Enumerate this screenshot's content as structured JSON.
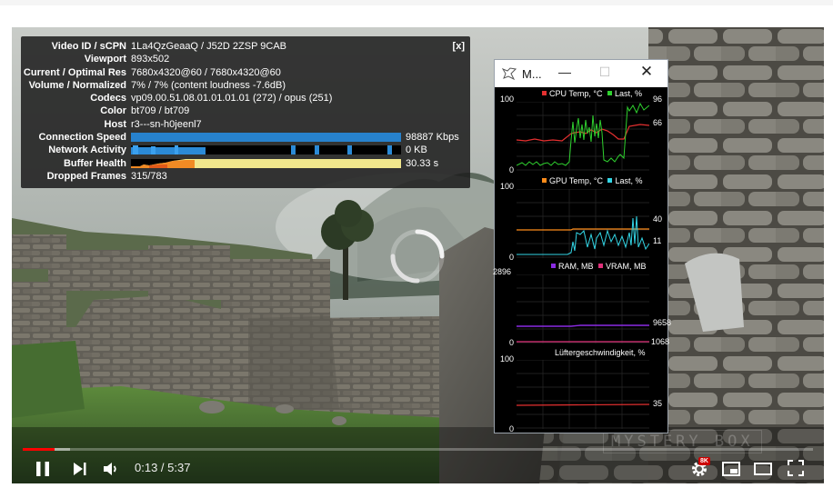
{
  "stats": {
    "close_label": "[x]",
    "rows": [
      {
        "key": "Video ID / sCPN",
        "value": "1La4QzGeaaQ / J52D 2ZSP 9CAB"
      },
      {
        "key": "Viewport",
        "value": "893x502"
      },
      {
        "key": "Current / Optimal Res",
        "value": "7680x4320@60 / 7680x4320@60"
      },
      {
        "key": "Volume / Normalized",
        "value": "7% / 7% (content loudness -7.6dB)"
      },
      {
        "key": "Codecs",
        "value": "vp09.00.51.08.01.01.01.01 (272) / opus (251)"
      },
      {
        "key": "Color",
        "value": "bt709 / bt709"
      },
      {
        "key": "Host",
        "value": "r3---sn-h0jeenl7"
      }
    ],
    "connection_speed": {
      "key": "Connection Speed",
      "value": "98887 Kbps"
    },
    "network_activity": {
      "key": "Network Activity",
      "value": "0 KB"
    },
    "buffer_health": {
      "key": "Buffer Health",
      "value": "30.33 s"
    },
    "dropped_frames": {
      "key": "Dropped Frames",
      "value": "315/783"
    }
  },
  "player": {
    "time": "0:13 / 5:37",
    "watermark": "MYSTERY BOX",
    "progress_fraction": 0.04,
    "buffer_fraction": 0.06,
    "settings_badge": "8K"
  },
  "monitor": {
    "title": "M...",
    "cpu": {
      "label_a": "CPU Temp, °C",
      "label_b": "Last, %",
      "axis_top": "100",
      "axis_bottom": "0",
      "val_a": "96",
      "val_b": "66"
    },
    "gpu": {
      "label_a": "GPU Temp, °C",
      "label_b": "Last, %",
      "axis_top": "100",
      "axis_bottom": "0",
      "val_a": "40",
      "val_b": "11"
    },
    "mem": {
      "label_a": "RAM, MB",
      "label_b": "VRAM, MB",
      "axis_top": "2896",
      "axis_bottom": "0",
      "val_a": "9658",
      "val_b": "1068"
    },
    "fan": {
      "label_a": "Lüftergeschwindigkeit, %",
      "axis_top": "100",
      "axis_bottom": "0",
      "val_a": "35"
    },
    "colors": {
      "cpu_temp": "#e53030",
      "cpu_load": "#2fd12f",
      "gpu_temp": "#ff8c1a",
      "gpu_load": "#33d6e6",
      "ram": "#8a2be2",
      "vram": "#e0307a",
      "fan": "#e53030"
    }
  },
  "icons": [
    "pause-icon",
    "next-icon",
    "volume-icon",
    "settings-icon",
    "miniplayer-icon",
    "theater-icon",
    "fullscreen-icon",
    "app-icon",
    "minimize-icon",
    "maximize-icon",
    "close-icon"
  ]
}
